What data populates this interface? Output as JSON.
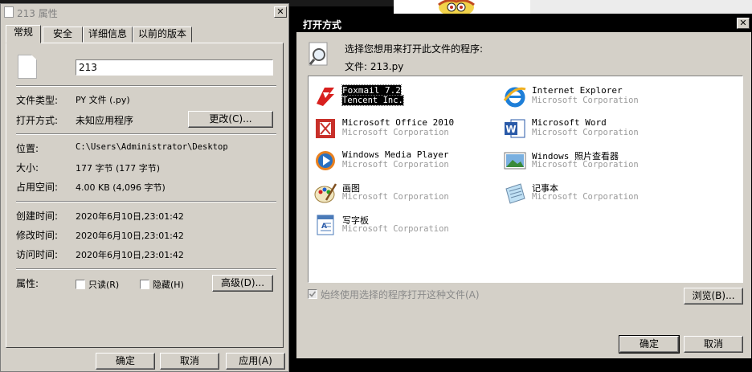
{
  "properties": {
    "title": "213 属性",
    "tabs": [
      "常规",
      "安全",
      "详细信息",
      "以前的版本"
    ],
    "file_name": "213",
    "file_type_label": "文件类型:",
    "file_type_value": "PY 文件 (.py)",
    "open_with_label": "打开方式:",
    "open_with_value": "未知应用程序",
    "change_button": "更改(C)...",
    "location_label": "位置:",
    "location_value": "C:\\Users\\Administrator\\Desktop",
    "size_label": "大小:",
    "size_value": "177 字节 (177 字节)",
    "size_on_disk_label": "占用空间:",
    "size_on_disk_value": "4.00 KB (4,096 字节)",
    "created_label": "创建时间:",
    "created_value": "2020年6月10日,23:01:42",
    "modified_label": "修改时间:",
    "modified_value": "2020年6月10日,23:01:42",
    "accessed_label": "访问时间:",
    "accessed_value": "2020年6月10日,23:01:42",
    "attributes_label": "属性:",
    "readonly_label": "只读(R)",
    "hidden_label": "隐藏(H)",
    "advanced_button": "高级(D)...",
    "ok_button": "确定",
    "cancel_button": "取消",
    "apply_button": "应用(A)"
  },
  "open_with": {
    "title": "打开方式",
    "prompt": "选择您想用来打开此文件的程序:",
    "file_line": "文件: 213.py",
    "programs": [
      {
        "name": "Foxmail 7.2",
        "vendor": "Tencent Inc.",
        "icon": "foxmail-icon",
        "selected": true
      },
      {
        "name": "Internet Explorer",
        "vendor": "Microsoft Corporation",
        "icon": "internet-explorer-icon",
        "selected": false
      },
      {
        "name": "Microsoft Office 2010",
        "vendor": "Microsoft Corporation",
        "icon": "office-icon",
        "selected": false
      },
      {
        "name": "Microsoft Word",
        "vendor": "Microsoft Corporation",
        "icon": "word-icon",
        "selected": false
      },
      {
        "name": "Windows Media Player",
        "vendor": "Microsoft Corporation",
        "icon": "media-player-icon",
        "selected": false
      },
      {
        "name": "Windows 照片查看器",
        "vendor": "Microsoft Corporation",
        "icon": "photo-viewer-icon",
        "selected": false
      },
      {
        "name": "画图",
        "vendor": "Microsoft Corporation",
        "icon": "paint-icon",
        "selected": false
      },
      {
        "name": "记事本",
        "vendor": "Microsoft Corporation",
        "icon": "notepad-icon",
        "selected": false
      },
      {
        "name": "写字板",
        "vendor": "Microsoft Corporation",
        "icon": "wordpad-icon",
        "selected": false
      }
    ],
    "always_use_label": "始终使用选择的程序打开这种文件(A)",
    "browse_button": "浏览(B)...",
    "ok_button": "确定",
    "cancel_button": "取消"
  }
}
